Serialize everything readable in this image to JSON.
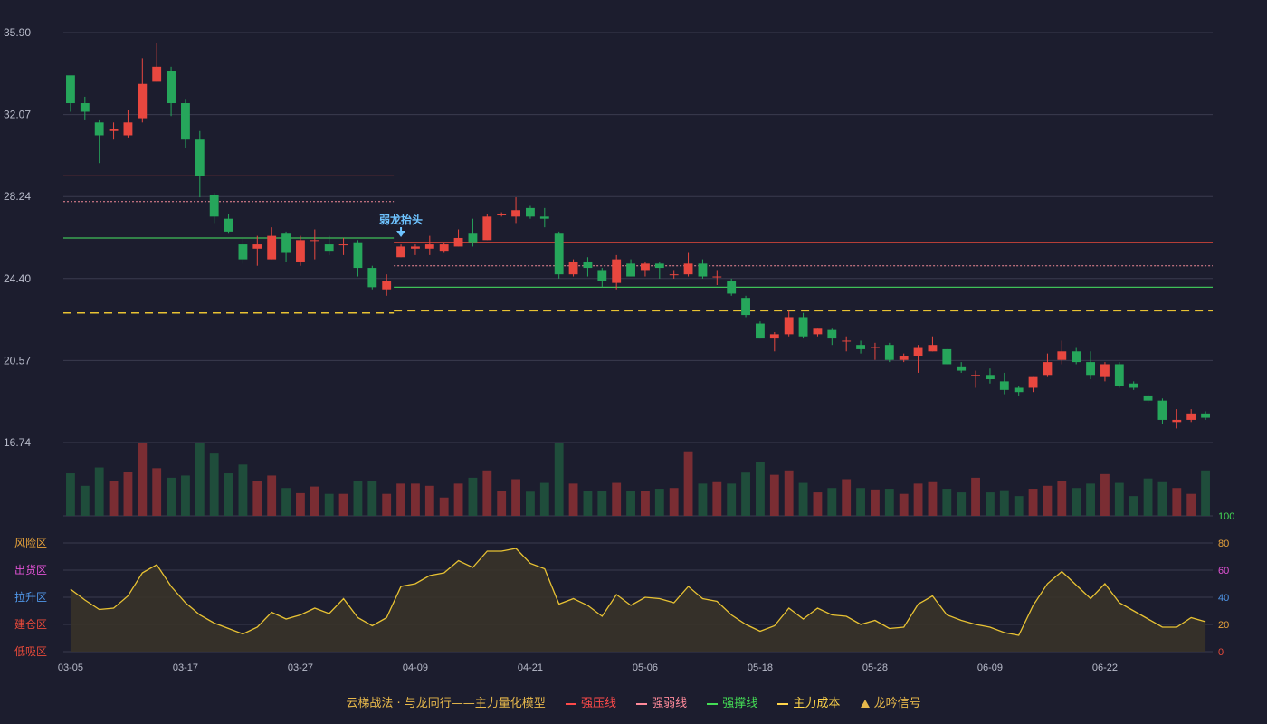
{
  "legend": {
    "title": "云梯战法 · 与龙同行——主力量化模型",
    "items": [
      {
        "label": "强压线",
        "color": "#ff4a4a",
        "style": "solid"
      },
      {
        "label": "强弱线",
        "color": "#ff8a9a",
        "style": "dashed"
      },
      {
        "label": "强撑线",
        "color": "#44dd55",
        "style": "solid"
      },
      {
        "label": "主力成本",
        "color": "#ffd54a",
        "style": "dashed"
      },
      {
        "label": "龙吟信号",
        "color": "#e7b84b",
        "style": "triangle"
      }
    ]
  },
  "colors": {
    "up": "#e8473f",
    "down": "#26a65b",
    "volume_up": "#7a2d33",
    "volume_down": "#1f4d3b",
    "oscillator_line": "#e8c233"
  },
  "chart_data": [
    {
      "type": "candlestick",
      "y_ticks": [
        "35.90",
        "32.07",
        "28.24",
        "24.40",
        "20.57",
        "16.74"
      ],
      "ylim": [
        16.74,
        35.9
      ],
      "x_ticks": [
        "03-05",
        "03-17",
        "03-27",
        "04-09",
        "04-21",
        "05-06",
        "05-18",
        "05-28",
        "06-09",
        "06-22"
      ],
      "x_tick_index": [
        0,
        8,
        16,
        24,
        32,
        40,
        48,
        56,
        64,
        72
      ],
      "ohlc": [
        [
          33.9,
          33.8,
          32.2,
          32.6
        ],
        [
          32.6,
          32.9,
          31.8,
          32.2
        ],
        [
          31.7,
          31.8,
          29.8,
          31.1
        ],
        [
          31.3,
          31.7,
          30.9,
          31.4
        ],
        [
          31.1,
          32.3,
          31.0,
          31.7
        ],
        [
          31.9,
          34.7,
          31.7,
          33.5
        ],
        [
          33.6,
          35.4,
          33.6,
          34.3
        ],
        [
          34.1,
          34.3,
          32.0,
          32.6
        ],
        [
          32.6,
          32.8,
          30.5,
          30.9
        ],
        [
          30.9,
          31.3,
          28.2,
          29.2
        ],
        [
          28.3,
          28.4,
          27.0,
          27.3
        ],
        [
          27.2,
          27.4,
          26.5,
          26.6
        ],
        [
          26.0,
          26.3,
          25.1,
          25.3
        ],
        [
          25.8,
          26.4,
          25.0,
          26.0
        ],
        [
          25.3,
          26.8,
          25.3,
          26.4
        ],
        [
          26.5,
          26.6,
          25.2,
          25.6
        ],
        [
          25.2,
          26.4,
          25.0,
          26.2
        ],
        [
          26.2,
          26.7,
          25.3,
          26.2
        ],
        [
          26.0,
          26.4,
          25.5,
          25.7
        ],
        [
          26.0,
          26.3,
          25.5,
          26.0
        ],
        [
          26.1,
          26.2,
          24.5,
          24.9
        ],
        [
          24.9,
          25.0,
          23.9,
          24.0
        ],
        [
          23.9,
          24.6,
          23.6,
          24.3
        ],
        [
          25.4,
          26.0,
          25.4,
          25.9
        ],
        [
          25.8,
          26.0,
          25.5,
          25.9
        ],
        [
          25.8,
          26.4,
          25.5,
          26.0
        ],
        [
          25.7,
          26.1,
          25.6,
          26.0
        ],
        [
          25.9,
          26.7,
          25.9,
          26.3
        ],
        [
          26.5,
          27.2,
          25.9,
          26.1
        ],
        [
          26.2,
          27.4,
          26.2,
          27.3
        ],
        [
          27.4,
          27.5,
          27.3,
          27.4
        ],
        [
          27.3,
          28.2,
          27.0,
          27.6
        ],
        [
          27.7,
          27.8,
          27.2,
          27.3
        ],
        [
          27.3,
          27.7,
          26.8,
          27.2
        ],
        [
          26.5,
          26.6,
          24.4,
          24.6
        ],
        [
          24.6,
          25.3,
          24.5,
          25.2
        ],
        [
          25.2,
          25.4,
          24.5,
          24.9
        ],
        [
          24.8,
          24.9,
          24.0,
          24.3
        ],
        [
          24.2,
          25.5,
          23.9,
          25.3
        ],
        [
          25.1,
          25.3,
          24.5,
          24.5
        ],
        [
          24.8,
          25.2,
          24.5,
          25.1
        ],
        [
          25.1,
          25.2,
          24.4,
          24.9
        ],
        [
          24.6,
          24.8,
          24.4,
          24.6
        ],
        [
          24.6,
          25.6,
          24.5,
          25.1
        ],
        [
          25.1,
          25.3,
          24.4,
          24.5
        ],
        [
          24.5,
          24.8,
          24.1,
          24.5
        ],
        [
          24.3,
          24.4,
          23.6,
          23.7
        ],
        [
          23.5,
          23.6,
          22.6,
          22.7
        ],
        [
          22.3,
          22.4,
          21.6,
          21.6
        ],
        [
          21.6,
          21.9,
          21.0,
          21.8
        ],
        [
          21.8,
          22.9,
          21.7,
          22.6
        ],
        [
          22.6,
          22.8,
          21.6,
          21.7
        ],
        [
          21.8,
          22.1,
          21.7,
          22.1
        ],
        [
          22.0,
          22.1,
          21.3,
          21.6
        ],
        [
          21.5,
          21.7,
          21.0,
          21.5
        ],
        [
          21.3,
          21.5,
          20.9,
          21.1
        ],
        [
          21.2,
          21.4,
          20.6,
          21.2
        ],
        [
          21.3,
          21.4,
          20.5,
          20.6
        ],
        [
          20.6,
          20.9,
          20.5,
          20.8
        ],
        [
          20.8,
          21.3,
          20.0,
          21.2
        ],
        [
          21.0,
          21.7,
          21.0,
          21.3
        ],
        [
          21.1,
          21.1,
          20.4,
          20.4
        ],
        [
          20.3,
          20.5,
          20.0,
          20.1
        ],
        [
          19.9,
          20.1,
          19.3,
          19.9
        ],
        [
          19.9,
          20.2,
          19.5,
          19.7
        ],
        [
          19.6,
          20.0,
          19.0,
          19.2
        ],
        [
          19.3,
          19.4,
          18.9,
          19.1
        ],
        [
          19.3,
          19.8,
          19.1,
          19.8
        ],
        [
          19.9,
          20.9,
          19.8,
          20.5
        ],
        [
          20.6,
          21.5,
          20.4,
          21.0
        ],
        [
          21.0,
          21.2,
          20.4,
          20.5
        ],
        [
          20.5,
          21.0,
          19.7,
          19.9
        ],
        [
          19.8,
          20.5,
          19.6,
          20.4
        ],
        [
          20.4,
          20.5,
          19.3,
          19.4
        ],
        [
          19.5,
          19.6,
          19.2,
          19.3
        ],
        [
          18.9,
          19.0,
          18.6,
          18.7
        ],
        [
          18.7,
          18.8,
          17.6,
          17.8
        ],
        [
          17.7,
          18.3,
          17.4,
          17.8
        ],
        [
          17.8,
          18.3,
          17.7,
          18.1
        ],
        [
          18.1,
          18.2,
          17.8,
          17.9
        ]
      ],
      "volume": [
        0.58,
        0.41,
        0.66,
        0.47,
        0.6,
        1.0,
        0.65,
        0.52,
        0.55,
        1.0,
        0.85,
        0.58,
        0.7,
        0.48,
        0.55,
        0.38,
        0.31,
        0.4,
        0.3,
        0.3,
        0.48,
        0.48,
        0.3,
        0.44,
        0.44,
        0.41,
        0.25,
        0.44,
        0.52,
        0.62,
        0.34,
        0.5,
        0.33,
        0.45,
        1.0,
        0.44,
        0.34,
        0.34,
        0.45,
        0.34,
        0.34,
        0.37,
        0.38,
        0.88,
        0.44,
        0.46,
        0.44,
        0.59,
        0.73,
        0.56,
        0.62,
        0.45,
        0.32,
        0.38,
        0.5,
        0.38,
        0.36,
        0.37,
        0.3,
        0.44,
        0.46,
        0.37,
        0.32,
        0.52,
        0.32,
        0.35,
        0.27,
        0.37,
        0.41,
        0.48,
        0.38,
        0.44,
        0.57,
        0.45,
        0.27,
        0.51,
        0.46,
        0.38,
        0.3,
        0.62
      ],
      "reference_lines": [
        {
          "name": "强压线",
          "segments": [
            {
              "from": 0,
              "to": 22,
              "value": 29.2
            },
            {
              "from": 23,
              "to": 79,
              "value": 26.1
            }
          ]
        },
        {
          "name": "强弱线",
          "segments": [
            {
              "from": 0,
              "to": 22,
              "value": 28.0
            },
            {
              "from": 23,
              "to": 79,
              "value": 25.0
            }
          ]
        },
        {
          "name": "强撑线",
          "segments": [
            {
              "from": 0,
              "to": 22,
              "value": 26.3
            },
            {
              "from": 23,
              "to": 79,
              "value": 24.0
            }
          ]
        },
        {
          "name": "主力成本",
          "segments": [
            {
              "from": 0,
              "to": 22,
              "value": 22.8
            },
            {
              "from": 23,
              "to": 79,
              "value": 22.9
            }
          ]
        }
      ],
      "annotations": [
        {
          "index": 23,
          "text": "弱龙抬头"
        }
      ]
    },
    {
      "type": "line",
      "zones": [
        "风险区",
        "出货区",
        "拉升区",
        "建仓区",
        "低吸区"
      ],
      "zone_colors": [
        "#e8a33a",
        "#e052d4",
        "#4f96e8",
        "#e84a3a",
        "#e84a3a"
      ],
      "y_ticks": [
        "100",
        "80",
        "60",
        "40",
        "20",
        "0"
      ],
      "y_tick_colors": [
        "#44dd55",
        "#e8a33a",
        "#e052d4",
        "#4f96e8",
        "#e8a33a",
        "#e84a3a"
      ],
      "ylim": [
        0,
        100
      ],
      "values": [
        46,
        38,
        31,
        32,
        41,
        58,
        64,
        48,
        36,
        27,
        21,
        17,
        13,
        18,
        29,
        24,
        27,
        32,
        28,
        39,
        25,
        19,
        25,
        48,
        50,
        56,
        58,
        67,
        62,
        74,
        74,
        76,
        65,
        61,
        35,
        39,
        34,
        26,
        42,
        34,
        40,
        39,
        36,
        48,
        39,
        37,
        27,
        20,
        15,
        19,
        32,
        24,
        32,
        27,
        26,
        20,
        23,
        17,
        18,
        35,
        41,
        27,
        23,
        20,
        18,
        14,
        12,
        34,
        50,
        59,
        49,
        39,
        50,
        36,
        30,
        24,
        18,
        18,
        25,
        22
      ]
    }
  ]
}
